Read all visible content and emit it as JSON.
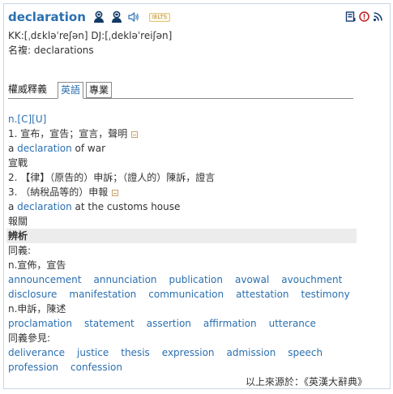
{
  "entry": {
    "word": "declaration",
    "exam_badge": "IELTS",
    "pronunciation": "KK:[ˌdɛkləˈreʃən] DJ:[ˌdekləˈreiʃən]",
    "plural": "名複: declarations"
  },
  "icons": {
    "speaker_us": "speaker-person-icon",
    "speaker_uk": "speaker-person-icon",
    "sound": "sound-icon",
    "bookmark": "notebook-icon",
    "report": "exclamation-icon",
    "rss": "rss-icon"
  },
  "tabs": {
    "authority": "權威釋義",
    "english": "英語",
    "professional": "專業"
  },
  "definitions": {
    "pos": "n.[C][U]",
    "sense1": "1. 宣布，宣告；宣言，聲明",
    "ex1_prefix": "a ",
    "ex1_word": "declaration",
    "ex1_suffix": " of war",
    "ex1_translation": "宣戰",
    "sense2": "2. 【律】（原告的）申訴；（證人的）陳訴，證言",
    "sense3": "3. （納稅品等的）申報",
    "ex3_prefix": "a ",
    "ex3_word": "declaration",
    "ex3_suffix": " at the customs house",
    "ex3_translation": "報關"
  },
  "analysis": {
    "title": "辨析",
    "synonyms_label": "同義:",
    "group1_label": "n.宣佈，宣告",
    "group1_row1": [
      "announcement",
      "annunciation",
      "publication",
      "avowal",
      "avouchment"
    ],
    "group1_row2": [
      "disclosure",
      "manifestation",
      "communication",
      "attestation",
      "testimony"
    ],
    "group2_label": "n.申訴，陳述",
    "group2_row1": [
      "proclamation",
      "statement",
      "assertion",
      "affirmation",
      "utterance"
    ],
    "see_also_label": "同義參見:",
    "see_also_row1": [
      "deliverance",
      "justice",
      "thesis",
      "expression",
      "admission",
      "speech"
    ],
    "see_also_row2": [
      "profession",
      "confession"
    ]
  },
  "source": "以上來源於：《英漢大辭典》"
}
